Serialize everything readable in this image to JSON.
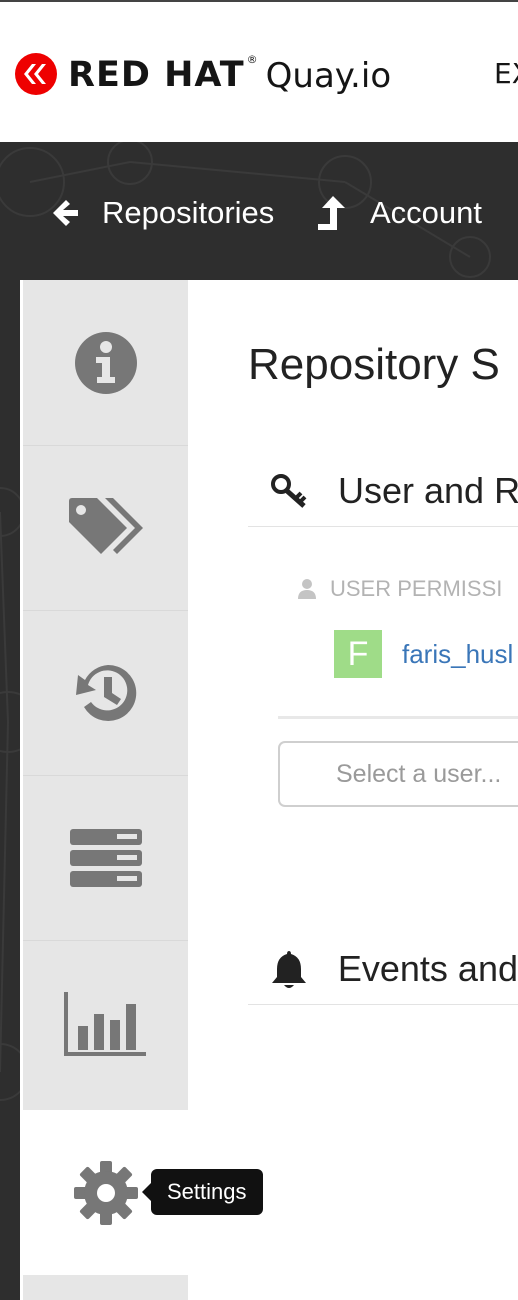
{
  "header": {
    "brand": "RED HAT",
    "brand_reg": "®",
    "product": "Quay.io",
    "right_cut_text": "EX"
  },
  "nav": {
    "repositories_label": "Repositories",
    "account_label": "Account"
  },
  "sidebar": {
    "tabs": [
      {
        "icon": "info-icon"
      },
      {
        "icon": "tags-icon"
      },
      {
        "icon": "history-icon"
      },
      {
        "icon": "builds-icon"
      },
      {
        "icon": "usage-logs-icon"
      },
      {
        "icon": "gear-icon",
        "active": true
      }
    ],
    "tooltip": "Settings"
  },
  "main": {
    "title": "Repository S",
    "user_section_title": "User and R",
    "permissions_label": "USER PERMISSI",
    "permission_user_initial": "F",
    "permission_user_name": "faris_husl",
    "select_placeholder": "Select a user...",
    "events_section_title": "Events and"
  },
  "colors": {
    "brand_red": "#ee0000",
    "dark_band": "#2e2e2e",
    "avatar": "#9fdc88",
    "link": "#3a76b8"
  }
}
